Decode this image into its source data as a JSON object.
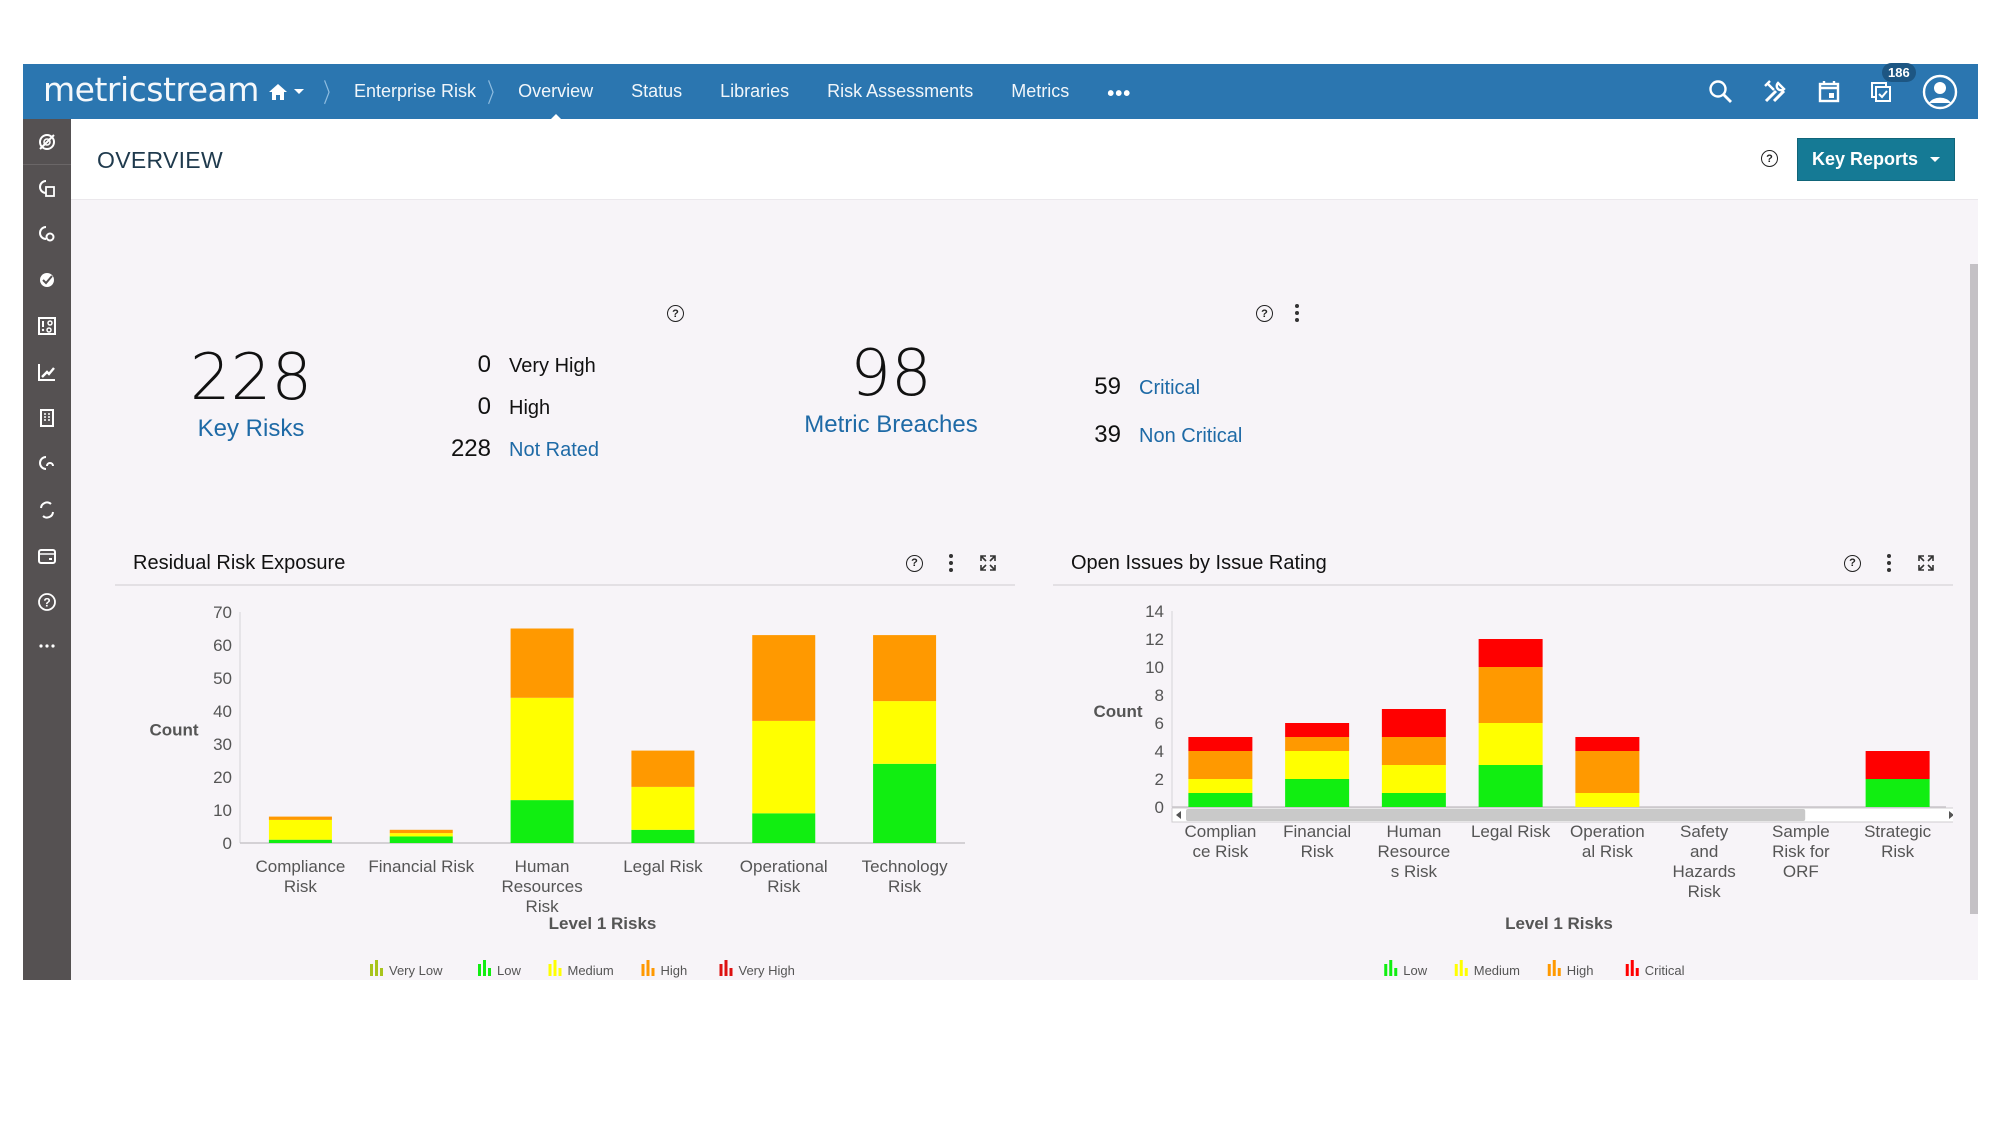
{
  "app": {
    "logo": "metricstream"
  },
  "topbar": {
    "breadcrumb": [
      {
        "label": "Enterprise Risk"
      }
    ],
    "nav_items": [
      {
        "label": "Overview",
        "active": true
      },
      {
        "label": "Status"
      },
      {
        "label": "Libraries"
      },
      {
        "label": "Risk Assessments"
      },
      {
        "label": "Metrics"
      }
    ],
    "more_label": "•••",
    "icons": [
      "search-icon",
      "tools-icon",
      "calendar-icon",
      "tasks-icon",
      "user-avatar-icon"
    ],
    "tasks_badge": "186",
    "color": "#2b76b0"
  },
  "sidebar": {
    "items": [
      {
        "icon": "risk-target-icon"
      },
      {
        "icon": "risk-register-icon"
      },
      {
        "icon": "risk-settings-icon"
      },
      {
        "icon": "control-check-icon"
      },
      {
        "icon": "issue-settings-icon"
      },
      {
        "icon": "metrics-trend-icon"
      },
      {
        "icon": "building-icon"
      },
      {
        "icon": "risk-refresh-icon"
      },
      {
        "icon": "cycle-icon"
      },
      {
        "icon": "wallet-icon"
      },
      {
        "icon": "help-icon"
      },
      {
        "icon": "more-icon"
      }
    ]
  },
  "page": {
    "title": "OVERVIEW",
    "key_reports_label": "Key Reports",
    "help_glyph": "?"
  },
  "kpis": {
    "key_risks": {
      "value": "228",
      "label": "Key Risks"
    },
    "risk_breakdown": [
      {
        "value": "0",
        "label": "Very High"
      },
      {
        "value": "0",
        "label": "High"
      },
      {
        "value": "228",
        "label": "Not Rated"
      }
    ],
    "metric_breaches": {
      "value": "98",
      "label": "Metric Breaches"
    },
    "breach_breakdown": [
      {
        "value": "59",
        "label": "Critical"
      },
      {
        "value": "39",
        "label": "Non Critical"
      }
    ]
  },
  "chart_data": [
    {
      "type": "bar",
      "stacked": true,
      "title": "Residual Risk Exposure",
      "xlabel": "Level 1 Risks",
      "ylabel": "Count",
      "ylim": [
        0,
        70
      ],
      "yticks": [
        "0",
        "10",
        "20",
        "30",
        "40",
        "50",
        "60",
        "70"
      ],
      "categories": [
        "Compliance Risk",
        "Financial Risk",
        "Human Resources Risk",
        "Legal Risk",
        "Operational Risk",
        "Technology Risk"
      ],
      "category_lines": [
        [
          "Compliance",
          "Risk"
        ],
        [
          "Financial Risk"
        ],
        [
          "Human",
          "Resources",
          "Risk"
        ],
        [
          "Legal Risk"
        ],
        [
          "Operational",
          "Risk"
        ],
        [
          "Technology",
          "Risk"
        ]
      ],
      "series": [
        {
          "name": "Very Low",
          "color": "#a8c41c",
          "values": [
            0,
            0,
            0,
            0,
            0,
            0
          ]
        },
        {
          "name": "Low",
          "color": "#11ee11",
          "values": [
            1,
            2,
            13,
            4,
            9,
            24
          ]
        },
        {
          "name": "Medium",
          "color": "#ffff00",
          "values": [
            6,
            1,
            31,
            13,
            28,
            19
          ]
        },
        {
          "name": "High",
          "color": "#ff9900",
          "values": [
            1,
            1,
            21,
            11,
            26,
            20
          ]
        },
        {
          "name": "Very High",
          "color": "#dd1111",
          "values": [
            0,
            0,
            0,
            0,
            0,
            0
          ]
        }
      ],
      "legend": "bottom-center",
      "grid": false
    },
    {
      "type": "bar",
      "stacked": true,
      "title": "Open Issues by Issue Rating",
      "xlabel": "Level 1 Risks",
      "ylabel": "Count",
      "ylim": [
        0,
        14
      ],
      "yticks": [
        "0",
        "2",
        "4",
        "6",
        "8",
        "10",
        "12",
        "14"
      ],
      "categories": [
        "Compliance Risk",
        "Financial Risk",
        "Human Resources Risk",
        "Legal Risk",
        "Operational Risk",
        "Safety and Hazards Risk",
        "Sample Risk for ORF",
        "Strategic Risk"
      ],
      "category_lines": [
        [
          "Complian",
          "ce Risk"
        ],
        [
          "Financial",
          "Risk"
        ],
        [
          "Human",
          "Resource",
          "s Risk"
        ],
        [
          "Legal Risk"
        ],
        [
          "Operation",
          "al Risk"
        ],
        [
          "Safety",
          "and",
          "Hazards",
          "Risk"
        ],
        [
          "Sample",
          "Risk for",
          "ORF"
        ],
        [
          "Strategic",
          "Risk"
        ]
      ],
      "series": [
        {
          "name": "Low",
          "color": "#11ee11",
          "values": [
            1,
            2,
            1,
            3,
            0,
            0,
            0,
            2
          ]
        },
        {
          "name": "Medium",
          "color": "#ffff00",
          "values": [
            1,
            2,
            2,
            3,
            1,
            0,
            0,
            0
          ]
        },
        {
          "name": "High",
          "color": "#ff9900",
          "values": [
            2,
            1,
            2,
            4,
            3,
            0,
            0,
            0
          ]
        },
        {
          "name": "Critical",
          "color": "#ff0000",
          "values": [
            1,
            1,
            2,
            2,
            1,
            0,
            0,
            2
          ]
        }
      ],
      "legend": "bottom-center",
      "grid": false,
      "has_horizontal_scrollbar": true
    }
  ]
}
